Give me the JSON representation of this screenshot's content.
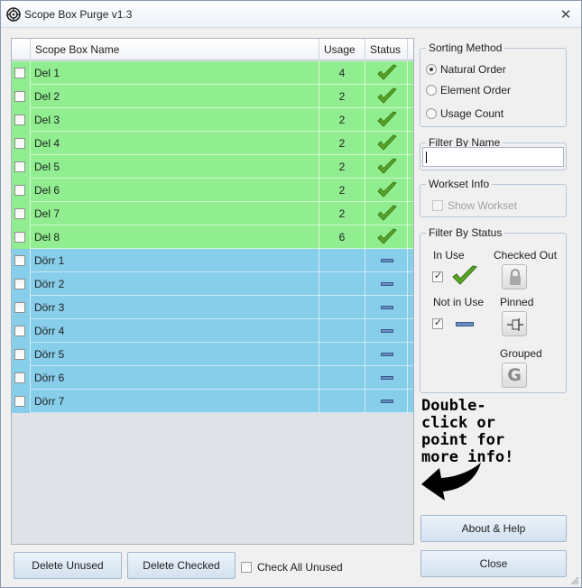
{
  "window": {
    "title": "Scope Box Purge v1.3",
    "close_glyph": "✕"
  },
  "grid": {
    "columns": {
      "name": "Scope Box Name",
      "usage": "Usage",
      "status": "Status"
    },
    "rows": [
      {
        "name": "Del 1",
        "usage": "4",
        "status": "in-use",
        "color": "#90ee90",
        "checked": false
      },
      {
        "name": "Del 2",
        "usage": "2",
        "status": "in-use",
        "color": "#90ee90",
        "checked": false
      },
      {
        "name": "Del 3",
        "usage": "2",
        "status": "in-use",
        "color": "#90ee90",
        "checked": false
      },
      {
        "name": "Del 4",
        "usage": "2",
        "status": "in-use",
        "color": "#90ee90",
        "checked": false
      },
      {
        "name": "Del 5",
        "usage": "2",
        "status": "in-use",
        "color": "#90ee90",
        "checked": false
      },
      {
        "name": "Del 6",
        "usage": "2",
        "status": "in-use",
        "color": "#90ee90",
        "checked": false
      },
      {
        "name": "Del 7",
        "usage": "2",
        "status": "in-use",
        "color": "#90ee90",
        "checked": false
      },
      {
        "name": "Del 8",
        "usage": "6",
        "status": "in-use",
        "color": "#90ee90",
        "checked": false
      },
      {
        "name": "Dörr 1",
        "usage": "",
        "status": "not-in-use",
        "color": "#87ceeb",
        "checked": false
      },
      {
        "name": "Dörr 2",
        "usage": "",
        "status": "not-in-use",
        "color": "#87ceeb",
        "checked": false
      },
      {
        "name": "Dörr 3",
        "usage": "",
        "status": "not-in-use",
        "color": "#87ceeb",
        "checked": false
      },
      {
        "name": "Dörr 4",
        "usage": "",
        "status": "not-in-use",
        "color": "#87ceeb",
        "checked": false
      },
      {
        "name": "Dörr 5",
        "usage": "",
        "status": "not-in-use",
        "color": "#87ceeb",
        "checked": false
      },
      {
        "name": "Dörr 6",
        "usage": "",
        "status": "not-in-use",
        "color": "#87ceeb",
        "checked": false
      },
      {
        "name": "Dörr 7",
        "usage": "",
        "status": "not-in-use",
        "color": "#87ceeb",
        "checked": false
      }
    ]
  },
  "sorting": {
    "title": "Sorting Method",
    "options": [
      {
        "label": "Natural Order",
        "selected": true
      },
      {
        "label": "Element Order",
        "selected": false
      },
      {
        "label": "Usage Count",
        "selected": false
      }
    ]
  },
  "filter_name": {
    "title": "Filter By Name",
    "value": ""
  },
  "workset": {
    "title": "Workset Info",
    "show_label": "Show Workset",
    "checked": false,
    "enabled": false
  },
  "filter_status": {
    "title": "Filter By Status",
    "in_use": {
      "label": "In Use",
      "checked": true
    },
    "checked_out": {
      "label": "Checked Out",
      "icon": "lock-icon"
    },
    "not_in_use": {
      "label": "Not in Use",
      "checked": true
    },
    "pinned": {
      "label": "Pinned",
      "icon": "pin-icon"
    },
    "grouped": {
      "label": "Grouped",
      "icon": "group-g-icon",
      "glyph": "G"
    }
  },
  "hint": {
    "text": "Double-\nclick or\npoint for\nmore info!"
  },
  "buttons": {
    "about": "About & Help",
    "close": "Close",
    "delete_unused": "Delete Unused",
    "delete_checked": "Delete Checked"
  },
  "check_all_unused": {
    "label": "Check All Unused",
    "checked": false
  },
  "colors": {
    "in_use_row": "#90ee90",
    "not_in_use_row": "#87ceeb",
    "check_green": "#4e9a1f"
  }
}
